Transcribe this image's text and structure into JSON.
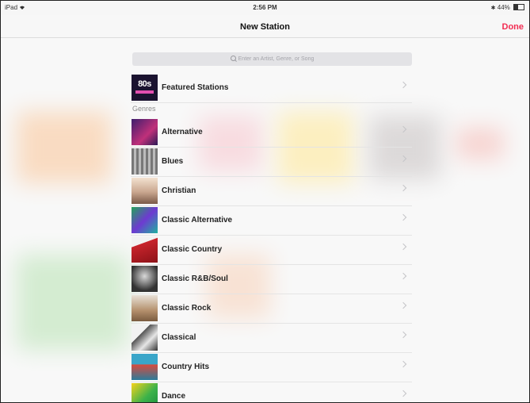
{
  "status_bar": {
    "device": "iPad",
    "wifi_icon": "wifi-icon",
    "time": "2:56 PM",
    "battery": "44%"
  },
  "nav": {
    "title": "New Station",
    "done_label": "Done"
  },
  "search": {
    "placeholder": "Enter an Artist, Genre, or Song"
  },
  "featured": {
    "label": "Featured Stations",
    "thumb_text": "80s"
  },
  "genres_header": "Genres",
  "genres": [
    {
      "label": "Alternative"
    },
    {
      "label": "Blues"
    },
    {
      "label": "Christian"
    },
    {
      "label": "Classic Alternative"
    },
    {
      "label": "Classic Country"
    },
    {
      "label": "Classic R&B/Soul"
    },
    {
      "label": "Classic Rock"
    },
    {
      "label": "Classical"
    },
    {
      "label": "Country Hits"
    },
    {
      "label": "Dance"
    }
  ],
  "colors": {
    "accent": "#f22c52"
  }
}
